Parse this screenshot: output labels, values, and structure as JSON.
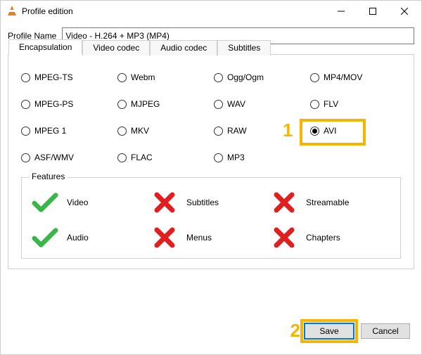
{
  "window": {
    "title": "Profile edition"
  },
  "profile": {
    "label": "Profile Name",
    "value": "Video - H.264 + MP3 (MP4)"
  },
  "tabs": [
    {
      "label": "Encapsulation",
      "active": true
    },
    {
      "label": "Video codec",
      "active": false
    },
    {
      "label": "Audio codec",
      "active": false
    },
    {
      "label": "Subtitles",
      "active": false
    }
  ],
  "encaps": {
    "options": [
      {
        "label": "MPEG-TS",
        "checked": false
      },
      {
        "label": "Webm",
        "checked": false
      },
      {
        "label": "Ogg/Ogm",
        "checked": false
      },
      {
        "label": "MP4/MOV",
        "checked": false
      },
      {
        "label": "MPEG-PS",
        "checked": false
      },
      {
        "label": "MJPEG",
        "checked": false
      },
      {
        "label": "WAV",
        "checked": false
      },
      {
        "label": "FLV",
        "checked": false
      },
      {
        "label": "MPEG 1",
        "checked": false
      },
      {
        "label": "MKV",
        "checked": false
      },
      {
        "label": "RAW",
        "checked": false
      },
      {
        "label": "AVI",
        "checked": true
      },
      {
        "label": "ASF/WMV",
        "checked": false
      },
      {
        "label": "FLAC",
        "checked": false
      },
      {
        "label": "MP3",
        "checked": false
      }
    ]
  },
  "features": {
    "title": "Features",
    "items": [
      {
        "label": "Video",
        "supported": true
      },
      {
        "label": "Subtitles",
        "supported": false
      },
      {
        "label": "Streamable",
        "supported": false
      },
      {
        "label": "Audio",
        "supported": true
      },
      {
        "label": "Menus",
        "supported": false
      },
      {
        "label": "Chapters",
        "supported": false
      }
    ]
  },
  "buttons": {
    "save": "Save",
    "cancel": "Cancel"
  },
  "callouts": {
    "avi": "1",
    "save": "2"
  }
}
